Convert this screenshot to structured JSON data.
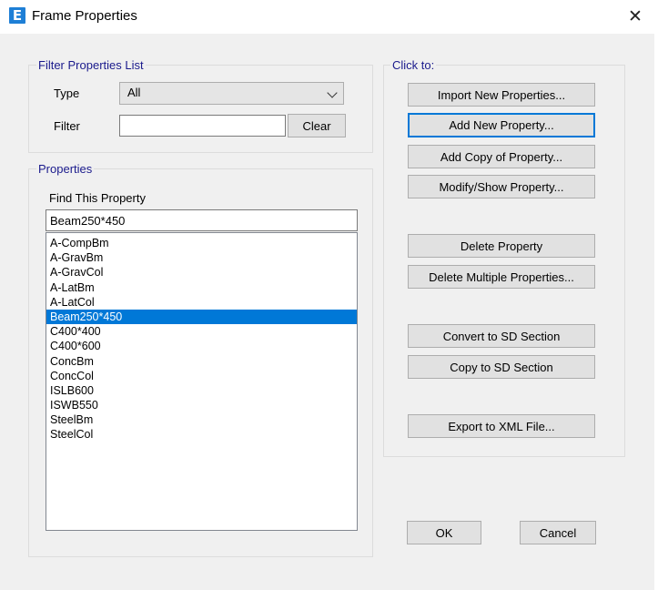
{
  "window": {
    "app_icon_letter": "E",
    "title": "Frame Properties",
    "close_glyph": "✕"
  },
  "filter_group": {
    "legend": "Filter Properties List",
    "type_label": "Type",
    "type_value": "All",
    "filter_label": "Filter",
    "filter_value": "",
    "clear_label": "Clear"
  },
  "properties_group": {
    "legend": "Properties",
    "find_label": "Find This Property",
    "find_value": "Beam250*450",
    "items": [
      "A-CompBm",
      "A-GravBm",
      "A-GravCol",
      "A-LatBm",
      "A-LatCol",
      "Beam250*450",
      "C400*400",
      "C400*600",
      "ConcBm",
      "ConcCol",
      "ISLB600",
      "ISWB550",
      "SteelBm",
      "SteelCol"
    ],
    "selected": "Beam250*450"
  },
  "click_to": {
    "legend": "Click to:",
    "import": "Import New Properties...",
    "add_new": "Add New Property...",
    "add_copy": "Add Copy of Property...",
    "modify": "Modify/Show Property...",
    "delete": "Delete Property",
    "delete_multiple": "Delete Multiple Properties...",
    "convert_sd": "Convert to SD Section",
    "copy_sd": "Copy to SD Section",
    "export_xml": "Export to XML File..."
  },
  "footer": {
    "ok": "OK",
    "cancel": "Cancel"
  },
  "colors": {
    "accent": "#0078d7",
    "legend_text": "#1a1a8c",
    "dialog_bg": "#f0f0f0"
  }
}
